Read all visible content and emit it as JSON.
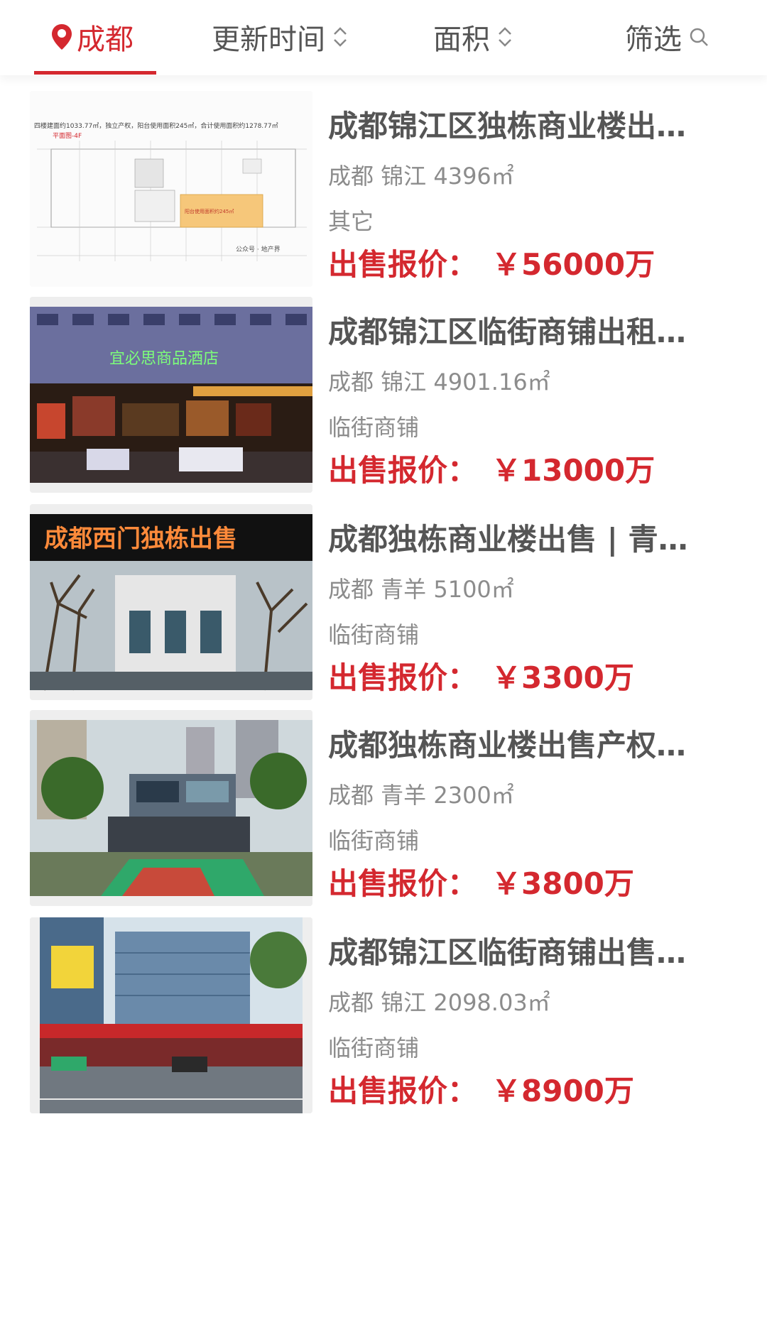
{
  "tabs": {
    "city": "成都",
    "update_time": "更新时间",
    "area": "面积",
    "filter": "筛选"
  },
  "colors": {
    "accent": "#d4282f",
    "text": "#555555",
    "muted": "#8c8c8c"
  },
  "listings": [
    {
      "title": "成都锦江区独栋商业楼出…",
      "meta": "成都 锦江 4396㎡",
      "category": "其它",
      "price_label": "出售报价：",
      "price": "￥56000万",
      "thumb_caption": "四楼建面约1033.77㎡，独立产权，阳台使用面积245㎡，合计使用面积约1278.77㎡",
      "thumb_sub": "平面图-4F",
      "thumb_highlight": "阳台使用面积约245㎡",
      "thumb_watermark": "公众号 · 地产界"
    },
    {
      "title": "成都锦江区临街商铺出租…",
      "meta": "成都 锦江 4901.16㎡",
      "category": "临街商铺",
      "price_label": "出售报价：",
      "price": "￥13000万",
      "thumb_sign": "宜必思商品酒店"
    },
    {
      "title": "成都独栋商业楼出售 | 青…",
      "meta": "成都 青羊 5100㎡",
      "category": "临街商铺",
      "price_label": "出售报价：",
      "price": "￥3300万",
      "thumb_banner": "成都西门独栋出售"
    },
    {
      "title": "成都独栋商业楼出售产权…",
      "meta": "成都 青羊 2300㎡",
      "category": "临街商铺",
      "price_label": "出售报价：",
      "price": "￥3800万"
    },
    {
      "title": "成都锦江区临街商铺出售…",
      "meta": "成都 锦江 2098.03㎡",
      "category": "临街商铺",
      "price_label": "出售报价：",
      "price": "￥8900万"
    }
  ]
}
